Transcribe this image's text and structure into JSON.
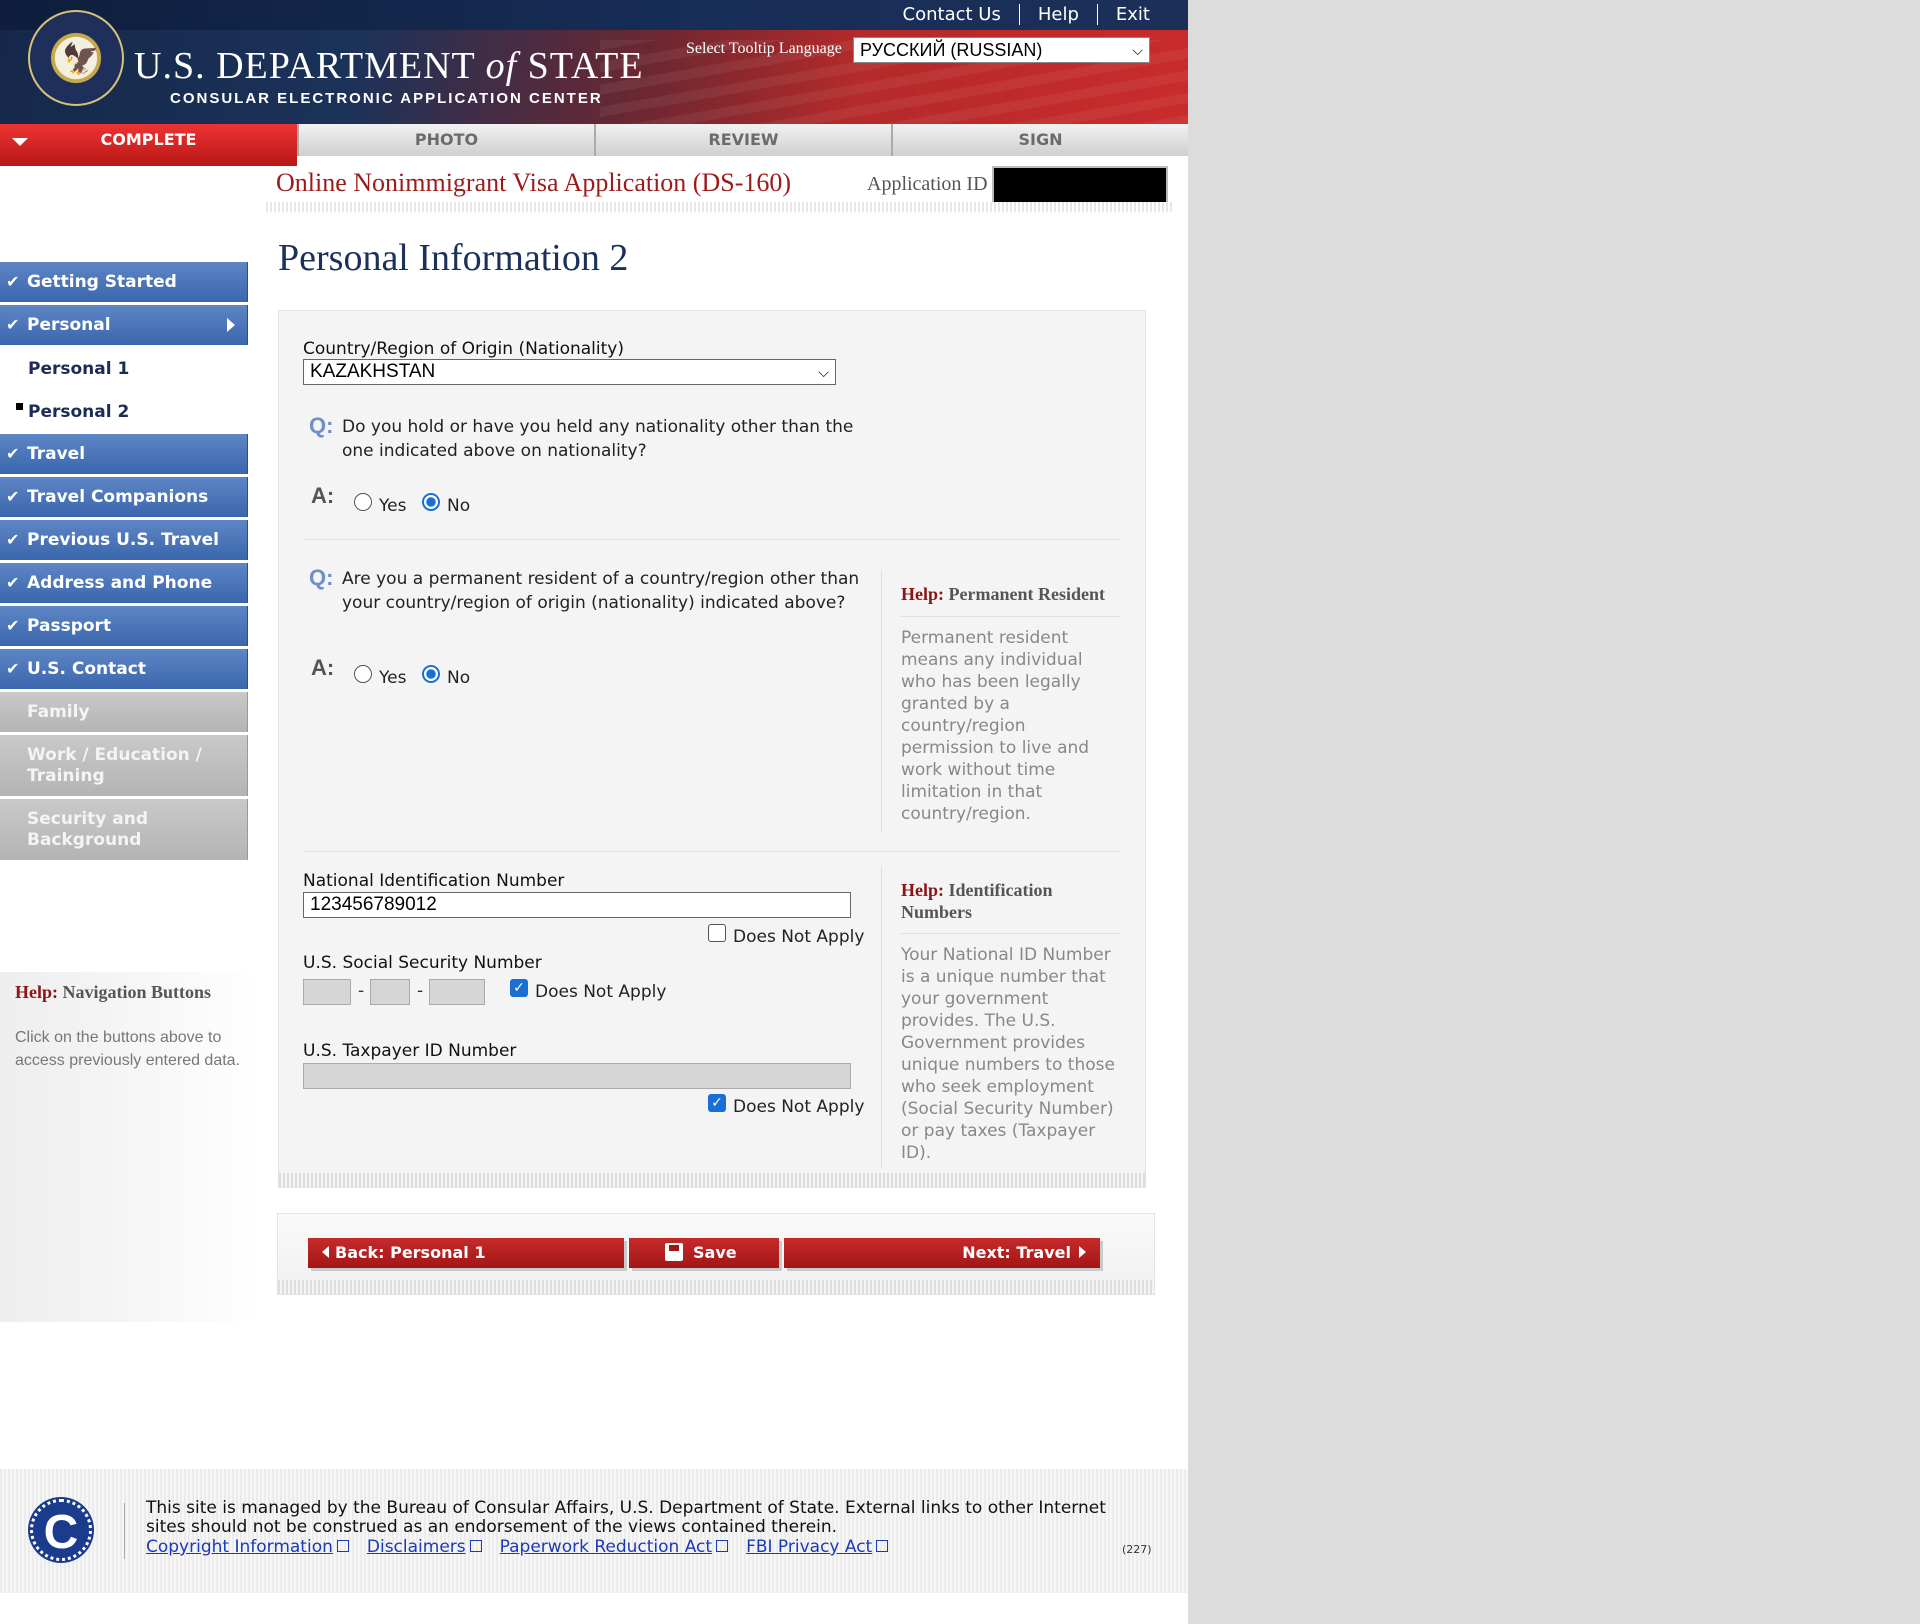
{
  "header": {
    "dept_title_main": "U.S. DEPARTMENT",
    "dept_title_of": "of",
    "dept_title_end": "STATE",
    "subtitle": "CONSULAR ELECTRONIC APPLICATION CENTER",
    "links": [
      "Contact Us",
      "Help",
      "Exit"
    ],
    "tooltip_language_label": "Select Tooltip Language",
    "tooltip_language_value": "РУССКИЙ (RUSSIAN)"
  },
  "tabs": [
    "COMPLETE",
    "PHOTO",
    "REVIEW",
    "SIGN"
  ],
  "app": {
    "title": "Online Nonimmigrant Visa Application (DS-160)",
    "id_label": "Application ID"
  },
  "page_heading": "Personal Information 2",
  "sidebar": {
    "items": [
      {
        "label": "Getting Started",
        "state": "complete"
      },
      {
        "label": "Personal",
        "state": "complete-current"
      },
      {
        "label": "Personal 1",
        "state": "sub"
      },
      {
        "label": "Personal 2",
        "state": "sub-current"
      },
      {
        "label": "Travel",
        "state": "complete"
      },
      {
        "label": "Travel Companions",
        "state": "complete"
      },
      {
        "label": "Previous U.S. Travel",
        "state": "complete"
      },
      {
        "label": "Address and Phone",
        "state": "complete"
      },
      {
        "label": "Passport",
        "state": "complete"
      },
      {
        "label": "U.S. Contact",
        "state": "complete"
      },
      {
        "label": "Family",
        "state": "incomplete"
      },
      {
        "label": "Work / Education / Training",
        "state": "incomplete"
      },
      {
        "label": "Security and Background",
        "state": "incomplete"
      }
    ],
    "help": {
      "prefix": "Help:",
      "title": "Navigation Buttons",
      "body": "Click on the buttons above to access previously entered data."
    }
  },
  "form": {
    "nationality_label": "Country/Region of Origin (Nationality)",
    "nationality_value": "KAZAKHSTAN",
    "q_mark": "Q:",
    "a_mark": "A:",
    "q1": "Do you hold or have you held any nationality other than the one indicated above on nationality?",
    "q2": "Are you a permanent resident of a country/region other than your country/region of origin (nationality) indicated above?",
    "yes": "Yes",
    "no": "No",
    "q1_answer": "No",
    "q2_answer": "No",
    "help_pr_prefix": "Help:",
    "help_pr_title": "Permanent Resident",
    "help_pr_body": "Permanent resident means any individual who has been legally granted by a country/region permission to live and work without time limitation in that country/region.",
    "national_id_label": "National Identification Number",
    "national_id_value": "123456789012",
    "does_not_apply": "Does Not Apply",
    "ssn_label": "U.S. Social Security Number",
    "taxpayer_label": "U.S. Taxpayer ID Number",
    "help_id_prefix": "Help:",
    "help_id_title": "Identification Numbers",
    "help_id_body": "Your National ID Number is a unique number that your government provides. The U.S. Government provides unique numbers to those who seek employment (Social Security Number) or pay taxes (Taxpayer ID)."
  },
  "buttons": {
    "back": "Back: Personal 1",
    "save": "Save",
    "next": "Next: Travel"
  },
  "footer": {
    "text": "This site is managed by the Bureau of Consular Affairs, U.S. Department of State. External links to other Internet sites should not be construed as an endorsement of the views contained therein.",
    "links": [
      "Copyright Information",
      "Disclaimers",
      "Paperwork Reduction Act",
      "FBI Privacy Act"
    ],
    "version": "(227)"
  },
  "colors": {
    "nav_blue": "#3a66ad",
    "nav_gray": "#b4b4b4",
    "brand_red": "#b81717",
    "heading_navy": "#1b3159"
  }
}
